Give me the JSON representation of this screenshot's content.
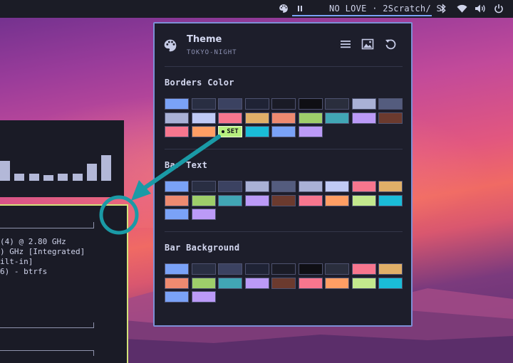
{
  "topbar": {
    "media_text": "NO LOVE · 2Scratch/ S",
    "icons": [
      "palette-icon",
      "pause-icon",
      "bluetooth-icon",
      "wifi-icon",
      "volume-icon",
      "power-icon"
    ]
  },
  "sysinfo": {
    "lines": [
      "(4) @ 2.80 GHz",
      ") GHz [Integrated]",
      "ilt-in]",
      "6) - btrfs"
    ]
  },
  "visualizer": {
    "levels": [
      0.35,
      0.12,
      0.12,
      0.1,
      0.12,
      0.12,
      0.3,
      0.45
    ]
  },
  "panel": {
    "title": "Theme",
    "subtitle": "TOKYO-NIGHT",
    "icons": [
      "palette-icon",
      "menu-icon",
      "image-icon",
      "reset-icon"
    ],
    "set_label": "SET",
    "sections": [
      {
        "title": "Borders Color",
        "swatches": [
          "#7aa2f7",
          "#292e42",
          "#3b4261",
          "#1f2335",
          "#1a1b26",
          "#0f0f14",
          "#2a2e3d",
          "#a9b1d6",
          "#545c7e",
          "#a9b1d6",
          "#c0caf5",
          "#f7768e",
          "#e0af68",
          "#ee8a70",
          "#9ece6a",
          "#41a6b5",
          "#bb9af7",
          "#6b3a2e",
          "#f7768e",
          "#ff9e64",
          "SET",
          "#1abcd8",
          "#7aa2f7",
          "#bb9af7"
        ]
      },
      {
        "title": "Bar Text",
        "swatches": [
          "#7aa2f7",
          "#292e42",
          "#3b4261",
          "#a9b1d6",
          "#545c7e",
          "#a9b1d6",
          "#c0caf5",
          "#f7768e",
          "#e0af68",
          "#ee8a70",
          "#9ece6a",
          "#41a6b5",
          "#bb9af7",
          "#6b3a2e",
          "#f7768e",
          "#ff9e64",
          "#c3e88d",
          "#1abcd8",
          "#7aa2f7",
          "#bb9af7"
        ]
      },
      {
        "title": "Bar Background",
        "swatches": [
          "#7aa2f7",
          "#292e42",
          "#3b4261",
          "#1f2335",
          "#1a1b26",
          "#0f0f14",
          "#2a2e3d",
          "#f7768e",
          "#e0af68",
          "#ee8a70",
          "#9ece6a",
          "#41a6b5",
          "#bb9af7",
          "#6b3a2e",
          "#f7768e",
          "#ff9e64",
          "#c3e88d",
          "#1abcd8",
          "#7aa2f7",
          "#bb9af7"
        ]
      }
    ]
  },
  "colors": {
    "accent": "#7aa2f7",
    "annotation": "#1a9aa6",
    "panel_bg": "#1d1e2b",
    "panel_border": "#7d8fd6"
  }
}
